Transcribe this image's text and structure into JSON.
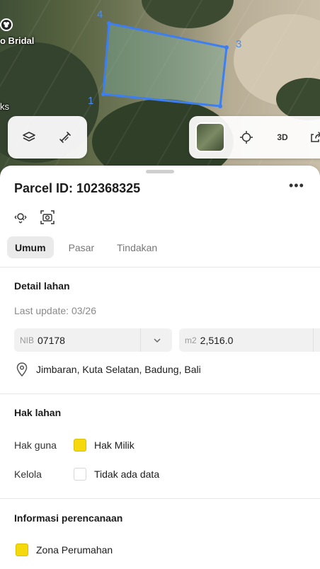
{
  "map": {
    "place_label": "o Bridal",
    "side_label": "ks",
    "corner_numbers": [
      "1",
      "3",
      "4"
    ],
    "controls": {
      "layers_icon": "layers-icon",
      "measure_icon": "ruler-icon",
      "locate_icon": "crosshair-icon",
      "view3d_label": "3D",
      "share_icon": "share-icon"
    },
    "parcel_outline_color": "#3d7ff0"
  },
  "parcel": {
    "title": "Parcel ID: 102368325",
    "more_label": "•••"
  },
  "tabs": [
    {
      "label": "Umum",
      "active": true
    },
    {
      "label": "Pasar",
      "active": false
    },
    {
      "label": "Tindakan",
      "active": false
    }
  ],
  "detail": {
    "section_title": "Detail lahan",
    "last_update": "Last update: 03/26",
    "nib_prefix": "NIB",
    "nib_value": "07178",
    "area_prefix": "m2",
    "area_value": "2,516.0",
    "address": "Jimbaran, Kuta Selatan, Badung, Bali"
  },
  "rights": {
    "section_title": "Hak lahan",
    "rows": [
      {
        "label": "Hak guna",
        "value": "Hak Milik",
        "color": "#f5d90c"
      },
      {
        "label": "Kelola",
        "value": "Tidak ada data",
        "color": "#ffffff"
      }
    ]
  },
  "planning": {
    "section_title": "Informasi perencanaan",
    "zone": "Zona Perumahan",
    "zone_color": "#f5d90c"
  }
}
